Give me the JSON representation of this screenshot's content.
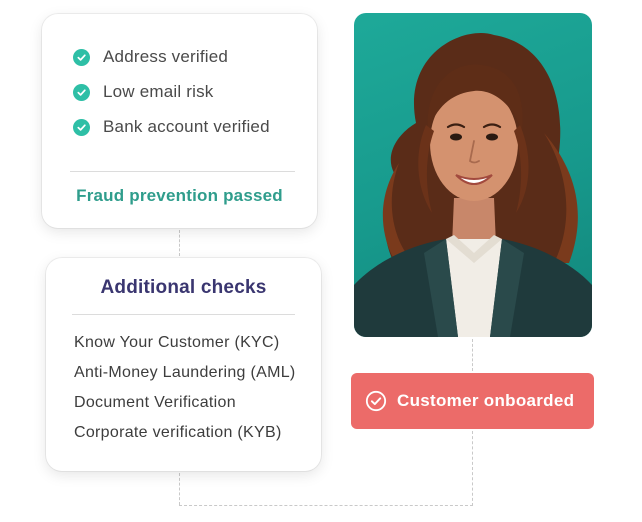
{
  "fraud_card": {
    "checks": [
      {
        "label": "Address verified",
        "icon": "check-circle-icon"
      },
      {
        "label": "Low email risk",
        "icon": "check-circle-icon"
      },
      {
        "label": "Bank account verified",
        "icon": "check-circle-icon"
      }
    ],
    "status": "Fraud prevention passed"
  },
  "additional_checks": {
    "title": "Additional checks",
    "items": [
      "Know Your Customer (KYC)",
      "Anti-Money Laundering (AML)",
      "Document Verification",
      "Corporate verification (KYB)"
    ]
  },
  "onboarding": {
    "label": "Customer onboarded",
    "icon": "check-circle-outline-icon"
  },
  "colors": {
    "check_green": "#2ebfa6",
    "status_teal": "#2f9d8c",
    "title_navy": "#3a3670",
    "onboard_red": "#ec6b69",
    "photo_teal": "#1ea999"
  }
}
